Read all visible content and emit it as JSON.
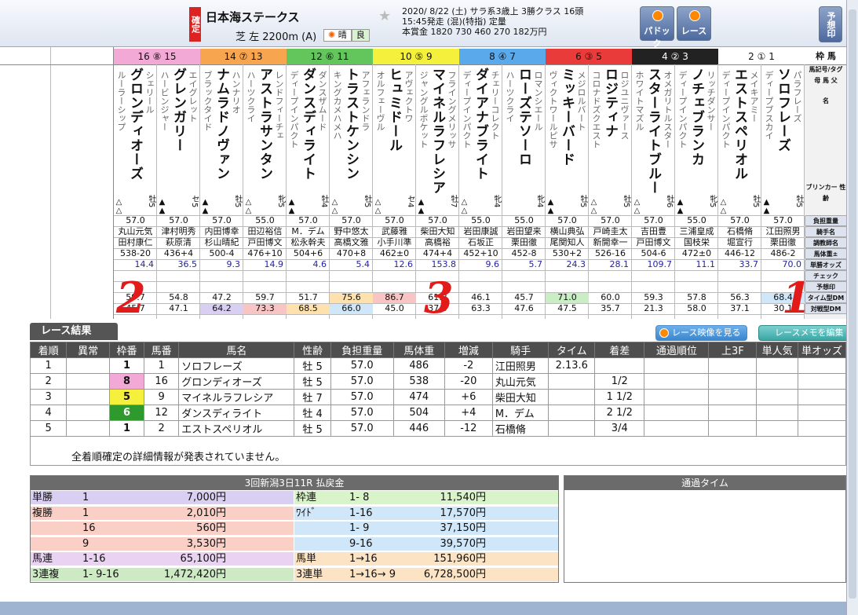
{
  "header": {
    "status": "確定",
    "race_name": "日本海ステークス",
    "course": "芝 左 2200m (A)",
    "weather": "晴",
    "going": "良",
    "info_line1": "2020/ 8/22 (土)  サラ系3歳上  3勝クラス  16頭",
    "info_line2": "15:45発走  (混)(特指) 定量",
    "info_line3": "本賞金 1820 730 460 270 182万円",
    "btn_paddock": "パドック",
    "btn_race": "レース",
    "btn_yoso": "予想印"
  },
  "waku_header": [
    {
      "label": "16  ⑧  15",
      "color": "#f3a9d6"
    },
    {
      "label": "14  ⑦  13",
      "color": "#f7a54f"
    },
    {
      "label": "12  ⑥  11",
      "color": "#62c65c"
    },
    {
      "label": "10  ⑤  9",
      "color": "#f4f03c"
    },
    {
      "label": "8  ④  7",
      "color": "#5aa9ea"
    },
    {
      "label": "6  ③  5",
      "color": "#ea3b3b"
    },
    {
      "label": "4  ②  3",
      "color": "#222222"
    },
    {
      "label": "2  ①  1",
      "color": "#ffffff"
    }
  ],
  "waku_label": "枠 馬",
  "horses": [
    {
      "name": "グロンディオーズ",
      "sire": "ルーラーシップ",
      "dam": "シェリール",
      "sex": "牡5",
      "mk": "△△",
      "wt": "57.0",
      "jockey": "丸山元気",
      "trainer": "田村康仁",
      "bw": "538-20",
      "odds": "14.4",
      "tm": "59.7",
      "vs": "45.7",
      "hl1": "",
      "hl2": ""
    },
    {
      "name": "グレンガリー",
      "sire": "ハービンジャー",
      "dam": "エイグレット",
      "sex": "セ5",
      "mk": "▲▲",
      "wt": "57.0",
      "jockey": "津村明秀",
      "trainer": "萩原清",
      "bw": "436+4",
      "odds": "36.5",
      "tm": "54.8",
      "vs": "47.1",
      "hl1": "",
      "hl2": ""
    },
    {
      "name": "ナムラドノヴァン",
      "sire": "ブラックタイド",
      "dam": "ハンナリオ",
      "sex": "牡5",
      "mk": "▲▲",
      "wt": "57.0",
      "jockey": "内田博幸",
      "trainer": "杉山晴紀",
      "bw": "500-4",
      "odds": "9.3",
      "tm": "47.2",
      "vs": "64.2",
      "hl1": "",
      "hl2": "hv"
    },
    {
      "name": "アストラサンタン",
      "sire": "ハーツクライ",
      "dam": "レンドフィーチェ",
      "sex": "牝5",
      "mk": "△△",
      "wt": "55.0",
      "jockey": "田辺裕信",
      "trainer": "戸田博文",
      "bw": "476+10",
      "odds": "14.9",
      "tm": "59.7",
      "vs": "73.3",
      "hl1": "",
      "hl2": "hp"
    },
    {
      "name": "ダンスディライト",
      "sire": "ディープインパクト",
      "dam": "ダンスザムード",
      "sex": "牡4",
      "mk": "▲▲",
      "wt": "57.0",
      "jockey": "M．デム",
      "trainer": "松永幹夫",
      "bw": "504+6",
      "odds": "4.6",
      "tm": "51.7",
      "vs": "68.5",
      "hl1": "",
      "hl2": "hl"
    },
    {
      "name": "トラストケンシン",
      "sire": "キングカメハメハ",
      "dam": "アフェランドラ",
      "sex": "牡5",
      "mk": "△△",
      "wt": "57.0",
      "jockey": "野中悠太",
      "trainer": "高橋文雅",
      "bw": "470+8",
      "odds": "5.4",
      "tm": "75.6",
      "vs": "66.0",
      "hl1": "hl",
      "hl2": "hb"
    },
    {
      "name": "ヒュミドール",
      "sire": "オルフェーヴル",
      "dam": "アヴェクトワ",
      "sex": "セ4",
      "mk": "△△",
      "wt": "57.0",
      "jockey": "武藤雅",
      "trainer": "小手川準",
      "bw": "462±0",
      "odds": "12.6",
      "tm": "86.7",
      "vs": "45.0",
      "hl1": "hp",
      "hl2": ""
    },
    {
      "name": "マイネルラフレシア",
      "sire": "ジャングルポケット",
      "dam": "フライングメリッサ",
      "sex": "牡7",
      "mk": "▲▲",
      "wt": "57.0",
      "jockey": "柴田大知",
      "trainer": "高橋裕",
      "bw": "474+4",
      "odds": "153.8",
      "tm": "61.2",
      "vs": "37.0",
      "hl1": "",
      "hl2": ""
    },
    {
      "name": "ダイアナブライト",
      "sire": "ディープインパクト",
      "dam": "チェリーコレクト",
      "sex": "牝4",
      "mk": "△△",
      "wt": "55.0",
      "jockey": "岩田康誠",
      "trainer": "石坂正",
      "bw": "452+10",
      "odds": "9.6",
      "tm": "46.1",
      "vs": "63.3",
      "hl1": "",
      "hl2": ""
    },
    {
      "name": "ローズテソーロ",
      "sire": "ハーツクライ",
      "dam": "ロマンシエール",
      "sex": "牝4",
      "mk": "",
      "wt": "55.0",
      "jockey": "岩田望来",
      "trainer": "栗田徹",
      "bw": "452-8",
      "odds": "5.7",
      "tm": "45.7",
      "vs": "47.6",
      "hl1": "",
      "hl2": ""
    },
    {
      "name": "ミッキーバード",
      "sire": "ヴィクトワールピサ",
      "dam": "メジロルバート",
      "sex": "牡5",
      "mk": "▲▲",
      "wt": "57.0",
      "jockey": "横山典弘",
      "trainer": "尾関知人",
      "bw": "530+2",
      "odds": "24.3",
      "tm": "71.0",
      "vs": "47.5",
      "hl1": "hg",
      "hl2": ""
    },
    {
      "name": "ロジティナ",
      "sire": "コロナドズクエスト",
      "dam": "ロジユニヴァース",
      "sex": "牡5",
      "mk": "△△",
      "wt": "57.0",
      "jockey": "戸崎圭太",
      "trainer": "新開幸一",
      "bw": "526-16",
      "odds": "28.1",
      "tm": "60.0",
      "vs": "35.7",
      "hl1": "",
      "hl2": ""
    },
    {
      "name": "スターライトブルー",
      "sire": "ホワイトマズル",
      "dam": "オメガリトルスター",
      "sex": "牡6",
      "mk": "△△",
      "wt": "57.0",
      "jockey": "吉田豊",
      "trainer": "戸田博文",
      "bw": "504-6",
      "odds": "109.7",
      "tm": "59.3",
      "vs": "21.3",
      "hl1": "",
      "hl2": ""
    },
    {
      "name": "ノチェブランカ",
      "sire": "ディープインパクト",
      "dam": "リッチダンサー",
      "sex": "牝5",
      "mk": "▲▲",
      "wt": "55.0",
      "jockey": "三浦皇成",
      "trainer": "国枝栄",
      "bw": "472±0",
      "odds": "11.1",
      "tm": "57.8",
      "vs": "58.0",
      "hl1": "",
      "hl2": ""
    },
    {
      "name": "エストスペリオル",
      "sire": "ディープインパクト",
      "dam": "メイキアミー",
      "sex": "牡5",
      "mk": "△△",
      "wt": "57.0",
      "jockey": "石橋脩",
      "trainer": "堀宣行",
      "bw": "446-12",
      "odds": "33.7",
      "tm": "56.3",
      "vs": "37.1",
      "hl1": "",
      "hl2": ""
    },
    {
      "name": "ソロフレーズ",
      "sire": "ディープブスカイ",
      "dam": "パラフレーズ",
      "sex": "牡5",
      "mk": "▲▲",
      "wt": "57.0",
      "jockey": "江田照男",
      "trainer": "栗田徹",
      "bw": "486-2",
      "odds": "70.0",
      "tm": "68.4",
      "vs": "30.1",
      "hl1": "hb",
      "hl2": ""
    }
  ],
  "row_labels": [
    "馬記号/タグ",
    "母 馬 父",
    "名",
    "ブリンカー 性齢",
    "負担重量",
    "騎手名",
    "調教師名",
    "馬体重±",
    "単勝オッズ",
    "チェック",
    "予想印",
    "タイム型DM",
    "対戦型DM"
  ],
  "annotations": [
    "2",
    "3",
    "1"
  ],
  "result": {
    "tab": "レース結果",
    "btn_video": "レース映像を見る",
    "btn_memo": "レースメモを編集",
    "headers": [
      "着順",
      "異常",
      "枠番",
      "馬番",
      "馬名",
      "性齢",
      "負担重量",
      "馬体重",
      "増減",
      "騎手",
      "タイム",
      "着差",
      "通過順位",
      "上3F",
      "単人気",
      "単オッズ"
    ],
    "rows": [
      {
        "pos": "1",
        "waku": "1",
        "wcol": "#ffffff",
        "wfg": "#111",
        "num": "1",
        "name": "ソロフレーズ",
        "sex": "牡 5",
        "wt": "57.0",
        "bw": "486",
        "diff": "-2",
        "jockey": "江田照男",
        "time": "2.13.6",
        "margin": ""
      },
      {
        "pos": "2",
        "waku": "8",
        "wcol": "#f3a9d6",
        "wfg": "#111",
        "num": "16",
        "name": "グロンディオーズ",
        "sex": "牡 5",
        "wt": "57.0",
        "bw": "538",
        "diff": "-20",
        "jockey": "丸山元気",
        "time": "",
        "margin": "1/2"
      },
      {
        "pos": "3",
        "waku": "5",
        "wcol": "#f4f03c",
        "wfg": "#111",
        "num": "9",
        "name": "マイネルラフレシア",
        "sex": "牡 7",
        "wt": "57.0",
        "bw": "474",
        "diff": "+6",
        "jockey": "柴田大知",
        "time": "",
        "margin": "1 1/2"
      },
      {
        "pos": "4",
        "waku": "6",
        "wcol": "#2e9a2e",
        "wfg": "#fff",
        "num": "12",
        "name": "ダンスディライト",
        "sex": "牡 4",
        "wt": "57.0",
        "bw": "504",
        "diff": "+4",
        "jockey": "M．デム",
        "time": "",
        "margin": "2 1/2"
      },
      {
        "pos": "5",
        "waku": "1",
        "wcol": "#ffffff",
        "wfg": "#111",
        "num": "2",
        "name": "エストスペリオル",
        "sex": "牡 5",
        "wt": "57.0",
        "bw": "446",
        "diff": "-12",
        "jockey": "石橋脩",
        "time": "",
        "margin": "3/4"
      }
    ],
    "notice": "全着順確定の詳細情報が発表されていません。"
  },
  "payout": {
    "title": "3回新潟3日11R 払戻金",
    "left": [
      {
        "type": "単勝",
        "comb": "1",
        "amt": "7,000円",
        "bg": "#d9cff2"
      },
      {
        "type": "複勝",
        "comb": "1",
        "amt": "2,010円",
        "bg": "#f9cfc6"
      },
      {
        "type": "",
        "comb": "16",
        "amt": "560円",
        "bg": "#f9cfc6"
      },
      {
        "type": "",
        "comb": "9",
        "amt": "3,530円",
        "bg": "#f9cfc6"
      },
      {
        "type": "馬連",
        "comb": "1-16",
        "amt": "65,100円",
        "bg": "#ead3f2"
      },
      {
        "type": "3連複",
        "comb": "1- 9-16",
        "amt": "1,472,420円",
        "bg": "#cdeac4"
      }
    ],
    "right": [
      {
        "type": "枠連",
        "comb": "1- 8",
        "amt": "11,540円",
        "bg": "#d9f4c9"
      },
      {
        "type": "ﾜｲﾄﾞ",
        "comb": "1-16",
        "amt": "17,570円",
        "bg": "#cfe7f9"
      },
      {
        "type": "",
        "comb": "1- 9",
        "amt": "37,150円",
        "bg": "#cfe7f9"
      },
      {
        "type": "",
        "comb": "9-16",
        "amt": "39,570円",
        "bg": "#cfe7f9"
      },
      {
        "type": "馬単",
        "comb": "1→16",
        "amt": "151,960円",
        "bg": "#fbe3c4"
      },
      {
        "type": "3連単",
        "comb": "1→16→ 9",
        "amt": "6,728,500円",
        "bg": "#fbe3c4"
      }
    ]
  },
  "passing": {
    "title": "通過タイム"
  }
}
